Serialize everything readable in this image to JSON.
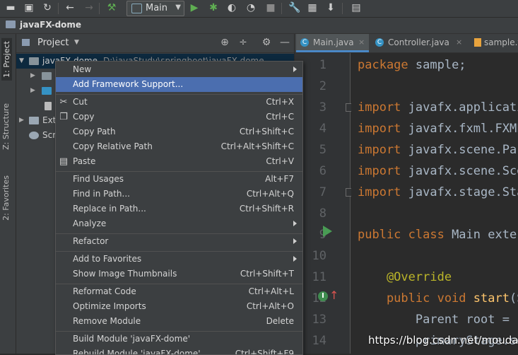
{
  "toolbar": {
    "run_config": "Main"
  },
  "navbar": {
    "project_name": "javaFX-dome"
  },
  "left_strip": {
    "tab_project": "1: Project",
    "tab_structure": "Z: Structure",
    "tab_favorites": "2: Favorites"
  },
  "project_panel": {
    "title": "Project",
    "root_name": "javaFX-dome",
    "root_path": "D:\\javaStudy\\springboot\\javaFX-dome",
    "ext_label": "Ext",
    "scr_label": "Scr"
  },
  "editor_tabs": [
    {
      "label": "Main.java"
    },
    {
      "label": "Controller.java"
    },
    {
      "label": "sample.fxml"
    }
  ],
  "context_menu": {
    "items": [
      {
        "label": "New",
        "shortcut": ""
      },
      {
        "label": "Add Framework Support...",
        "shortcut": ""
      },
      {
        "label": "Cut",
        "shortcut": "Ctrl+X"
      },
      {
        "label": "Copy",
        "shortcut": "Ctrl+C"
      },
      {
        "label": "Copy Path",
        "shortcut": "Ctrl+Shift+C"
      },
      {
        "label": "Copy Relative Path",
        "shortcut": "Ctrl+Alt+Shift+C"
      },
      {
        "label": "Paste",
        "shortcut": "Ctrl+V"
      },
      {
        "label": "Find Usages",
        "shortcut": "Alt+F7"
      },
      {
        "label": "Find in Path...",
        "shortcut": "Ctrl+Alt+Q"
      },
      {
        "label": "Replace in Path...",
        "shortcut": "Ctrl+Shift+R"
      },
      {
        "label": "Analyze",
        "shortcut": ""
      },
      {
        "label": "Refactor",
        "shortcut": ""
      },
      {
        "label": "Add to Favorites",
        "shortcut": ""
      },
      {
        "label": "Show Image Thumbnails",
        "shortcut": "Ctrl+Shift+T"
      },
      {
        "label": "Reformat Code",
        "shortcut": "Ctrl+Alt+L"
      },
      {
        "label": "Optimize Imports",
        "shortcut": "Ctrl+Alt+O"
      },
      {
        "label": "Remove Module",
        "shortcut": "Delete"
      },
      {
        "label": "Build Module 'javaFX-dome'",
        "shortcut": ""
      },
      {
        "label": "Rebuild Module 'javaFX-dome'",
        "shortcut": "Ctrl+Shift+F9"
      }
    ]
  },
  "editor": {
    "line_numbers": [
      "1",
      "2",
      "3",
      "4",
      "5",
      "6",
      "7",
      "8",
      "9",
      "10",
      "11",
      "12",
      "13",
      "14"
    ],
    "lines": [
      {
        "kw": "package",
        "rest": " sample;"
      },
      {
        "kw": "",
        "rest": ""
      },
      {
        "kw": "import",
        "rest": " javafx.applicati"
      },
      {
        "kw": "import",
        "rest": " javafx.fxml.FXML"
      },
      {
        "kw": "import",
        "rest": " javafx.scene.Par"
      },
      {
        "kw": "import",
        "rest": " javafx.scene.Sce"
      },
      {
        "kw": "import",
        "rest": " javafx.stage.Sta"
      },
      {
        "kw": "",
        "rest": ""
      },
      {
        "kw": "public class",
        "rest": " Main exter"
      },
      {
        "kw": "",
        "rest": ""
      },
      {
        "ann": "    @Override"
      },
      {
        "kw": "    public void",
        "fn": " start",
        "rest": "(S"
      },
      {
        "kw": "",
        "rest": "        Parent root = F"
      },
      {
        "kw": "",
        "rest": "        primaryStage.se"
      }
    ]
  },
  "watermark": "https://blog.csdn.net/mouday"
}
